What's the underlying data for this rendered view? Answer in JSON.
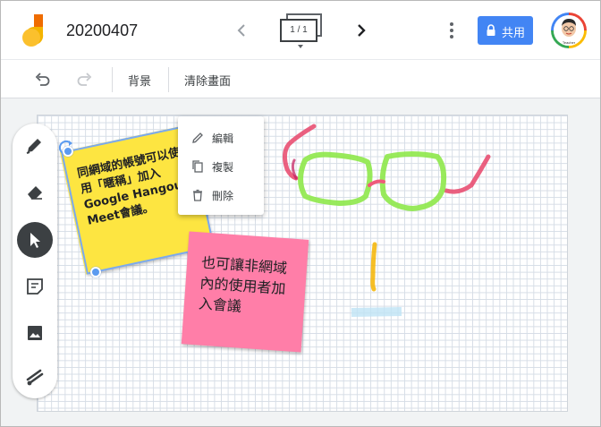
{
  "app": {
    "document_title": "20200407"
  },
  "header": {
    "page_indicator": "1 / 1",
    "share_label": "共用",
    "avatar_caption": "Teacher"
  },
  "toolbar": {
    "background_label": "背景",
    "clear_label": "清除畫面"
  },
  "context_menu": {
    "items": [
      {
        "label": "編輯",
        "icon": "pencil-icon"
      },
      {
        "label": "複製",
        "icon": "copy-icon"
      },
      {
        "label": "刪除",
        "icon": "trash-icon"
      }
    ]
  },
  "tools": [
    {
      "name": "pen-tool",
      "icon": "pen-icon",
      "active": false
    },
    {
      "name": "eraser-tool",
      "icon": "eraser-icon",
      "active": false
    },
    {
      "name": "select-tool",
      "icon": "pointer-icon",
      "active": true
    },
    {
      "name": "sticky-note-tool",
      "icon": "sticky-note-icon",
      "active": false
    },
    {
      "name": "image-tool",
      "icon": "image-icon",
      "active": false
    },
    {
      "name": "laser-tool",
      "icon": "laser-icon",
      "active": false
    }
  ],
  "notes": {
    "yellow": {
      "text": "同網域的帳號可以使用「暱稱」加入Google Hangouts Meet會議。",
      "color": "#fde541"
    },
    "pink": {
      "text": "也可讓非網域內的使用者加入會議",
      "color": "#ff7ea8"
    }
  },
  "colors": {
    "accent": "#4285f4",
    "selection": "#5b9bf0"
  }
}
